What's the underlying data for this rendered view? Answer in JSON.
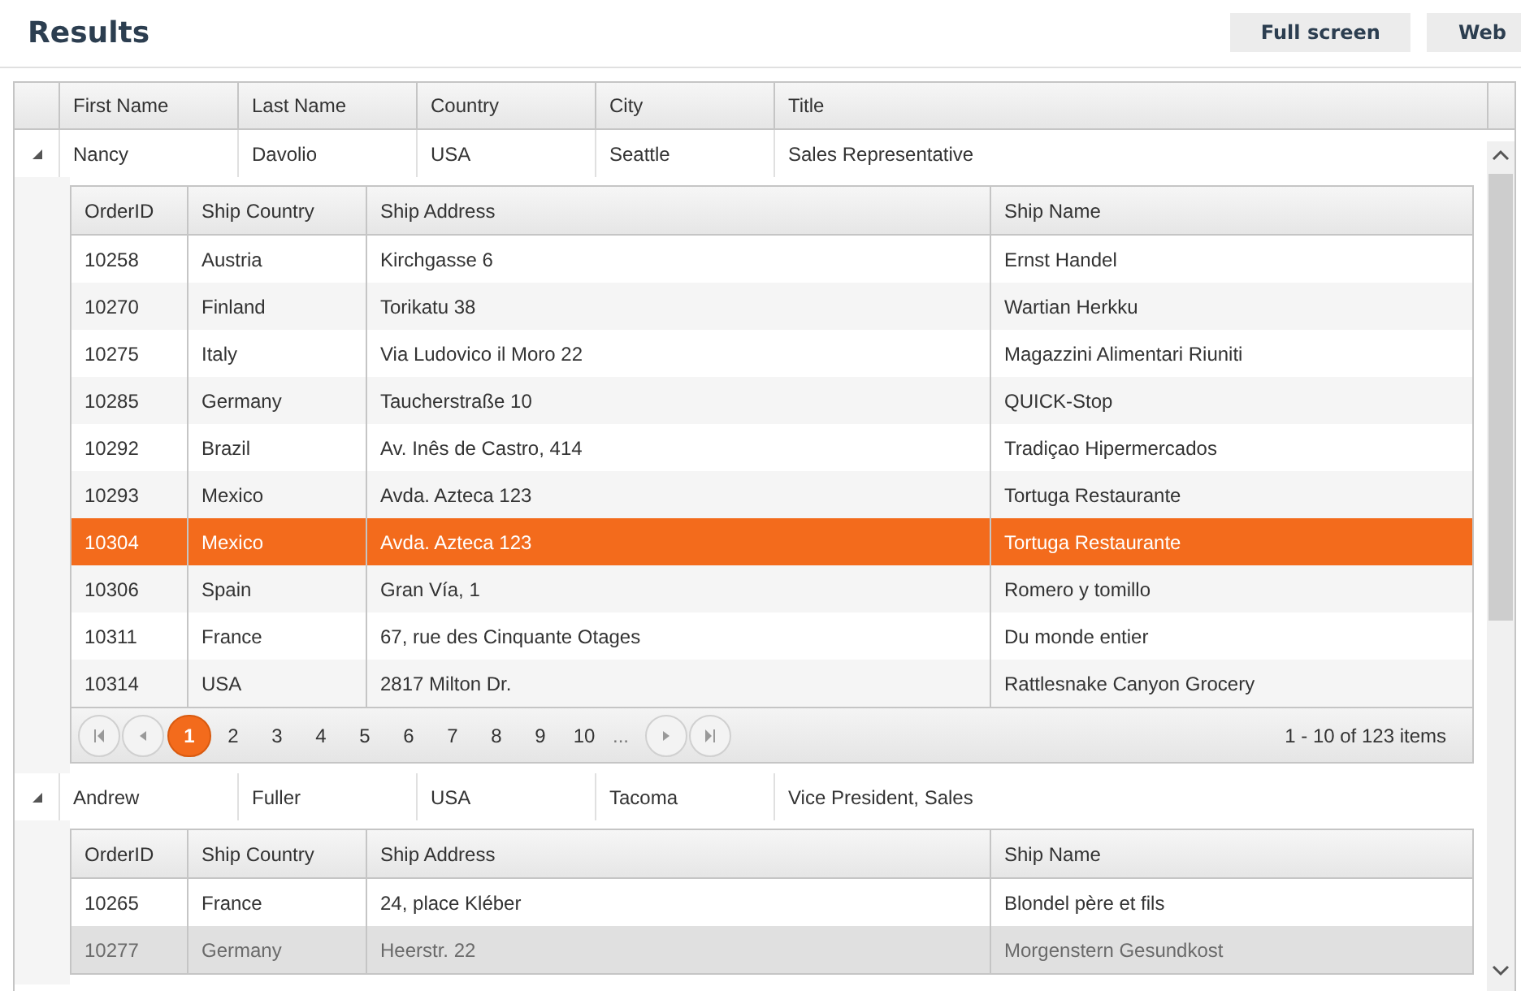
{
  "title": "Results",
  "toolbar_buttons": [
    "Full screen",
    "Web"
  ],
  "grid": {
    "columns": [
      "First Name",
      "Last Name",
      "Country",
      "City",
      "Title"
    ],
    "rows": [
      {
        "cells": [
          "Nancy",
          "Davolio",
          "USA",
          "Seattle",
          "Sales Representative"
        ],
        "expanded": true,
        "detail": {
          "columns": [
            "OrderID",
            "Ship Country",
            "Ship Address",
            "Ship Name"
          ],
          "rows": [
            {
              "cells": [
                "10258",
                "Austria",
                "Kirchgasse 6",
                "Ernst Handel"
              ],
              "selected": false,
              "hovered": false
            },
            {
              "cells": [
                "10270",
                "Finland",
                "Torikatu 38",
                "Wartian Herkku"
              ],
              "selected": false,
              "hovered": false
            },
            {
              "cells": [
                "10275",
                "Italy",
                "Via Ludovico il Moro 22",
                "Magazzini Alimentari Riuniti"
              ],
              "selected": false,
              "hovered": false
            },
            {
              "cells": [
                "10285",
                "Germany",
                "Taucherstraße 10",
                "QUICK-Stop"
              ],
              "selected": false,
              "hovered": false
            },
            {
              "cells": [
                "10292",
                "Brazil",
                "Av. Inês de Castro, 414",
                "Tradiçao Hipermercados"
              ],
              "selected": false,
              "hovered": false
            },
            {
              "cells": [
                "10293",
                "Mexico",
                "Avda. Azteca 123",
                "Tortuga Restaurante"
              ],
              "selected": false,
              "hovered": false
            },
            {
              "cells": [
                "10304",
                "Mexico",
                "Avda. Azteca 123",
                "Tortuga Restaurante"
              ],
              "selected": true,
              "hovered": false
            },
            {
              "cells": [
                "10306",
                "Spain",
                "Gran Vía, 1",
                "Romero y tomillo"
              ],
              "selected": false,
              "hovered": false
            },
            {
              "cells": [
                "10311",
                "France",
                "67, rue des Cinquante Otages",
                "Du monde entier"
              ],
              "selected": false,
              "hovered": false
            },
            {
              "cells": [
                "10314",
                "USA",
                "2817 Milton Dr.",
                "Rattlesnake Canyon Grocery"
              ],
              "selected": false,
              "hovered": false
            }
          ],
          "pager": {
            "pages": [
              {
                "label": "1",
                "selected": true
              },
              {
                "label": "2",
                "selected": false
              },
              {
                "label": "3",
                "selected": false
              },
              {
                "label": "4",
                "selected": false
              },
              {
                "label": "5",
                "selected": false
              },
              {
                "label": "6",
                "selected": false
              },
              {
                "label": "7",
                "selected": false
              },
              {
                "label": "8",
                "selected": false
              },
              {
                "label": "9",
                "selected": false
              },
              {
                "label": "10",
                "selected": false
              }
            ],
            "more": "...",
            "info": "1 - 10 of 123 items"
          }
        }
      },
      {
        "cells": [
          "Andrew",
          "Fuller",
          "USA",
          "Tacoma",
          "Vice President, Sales"
        ],
        "expanded": true,
        "detail": {
          "columns": [
            "OrderID",
            "Ship Country",
            "Ship Address",
            "Ship Name"
          ],
          "rows": [
            {
              "cells": [
                "10265",
                "France",
                "24, place Kléber",
                "Blondel père et fils"
              ],
              "selected": false,
              "hovered": false
            },
            {
              "cells": [
                "10277",
                "Germany",
                "Heerstr. 22",
                "Morgenstern Gesundkost"
              ],
              "selected": false,
              "hovered": true
            }
          ]
        }
      }
    ]
  }
}
